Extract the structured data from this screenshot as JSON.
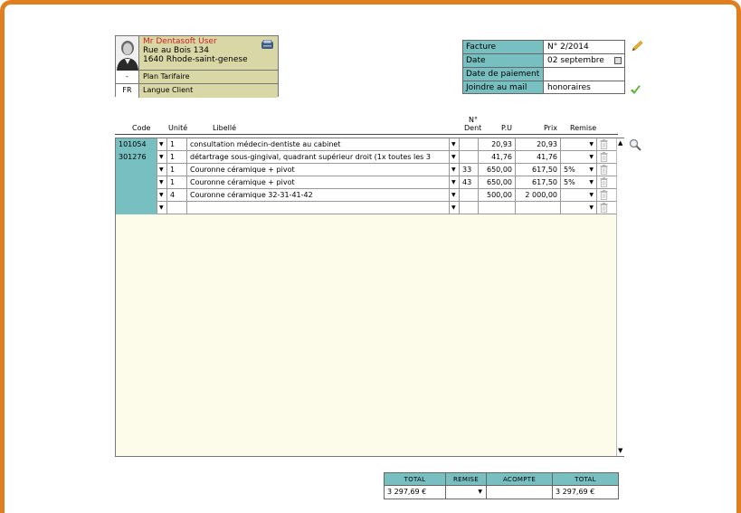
{
  "patient": {
    "name": "Mr Dentasoft User",
    "address_line1": "Rue au Bois 134",
    "address_line2": "1640 Rhode-saint-genese",
    "plan_key": "-",
    "plan_label": "Plan Tarifaire",
    "lang_key": "FR",
    "lang_label": "Langue Client"
  },
  "invoice": {
    "facture_label": "Facture",
    "facture_value": "N° 2/2014",
    "date_label": "Date",
    "date_value": "02 septembre",
    "paydate_label": "Date de paiement",
    "paydate_value": "",
    "mail_label": "Joindre au mail",
    "mail_value": "honoraires"
  },
  "table_header": {
    "code": "Code",
    "unit": "Unité",
    "libelle": "Libellé",
    "dent_top": "N°",
    "dent": "Dent",
    "pu": "P.U",
    "prix": "Prix",
    "remise": "Remise"
  },
  "rows": [
    {
      "code": "101054",
      "unit": "1",
      "libelle": "consultation médecin-dentiste au cabinet",
      "dent": "",
      "pu": "20,93",
      "prix": "20,93",
      "remise": ""
    },
    {
      "code": "301276",
      "unit": "1",
      "libelle": "détartrage sous-gingival, quadrant supérieur droit (1x toutes les 3",
      "dent": "",
      "pu": "41,76",
      "prix": "41,76",
      "remise": ""
    },
    {
      "code": "",
      "unit": "1",
      "libelle": "Couronne céramique + pivot",
      "dent": "33",
      "pu": "650,00",
      "prix": "617,50",
      "remise": "5%"
    },
    {
      "code": "",
      "unit": "1",
      "libelle": "Couronne céramique + pivot",
      "dent": "43",
      "pu": "650,00",
      "prix": "617,50",
      "remise": "5%"
    },
    {
      "code": "",
      "unit": "4",
      "libelle": "Couronne céramique 32-31-41-42",
      "dent": "",
      "pu": "500,00",
      "prix": "2 000,00",
      "remise": ""
    },
    {
      "code": "",
      "unit": "",
      "libelle": "",
      "dent": "",
      "pu": "",
      "prix": "",
      "remise": ""
    }
  ],
  "totals": {
    "total_label": "TOTAL",
    "remise_label": "REMISE",
    "acompte_label": "ACOMPTE",
    "total2_label": "TOTAL",
    "total_value": "3 297,69 €",
    "remise_value": "",
    "acompte_value": "",
    "total2_value": "3 297,69 €"
  },
  "colors": {
    "frame": "#e07f1f",
    "teal": "#78bfc2",
    "patient_bg": "#d9d7a6",
    "grid_bg": "#fdfcea",
    "name_red": "#cc2020"
  },
  "icons": [
    "card-reader-icon",
    "pencil-icon",
    "check-icon",
    "calendar-icon",
    "trash-icon",
    "magnifier-icon",
    "dropdown-arrow-icon",
    "scroll-up-icon",
    "scroll-down-icon"
  ]
}
